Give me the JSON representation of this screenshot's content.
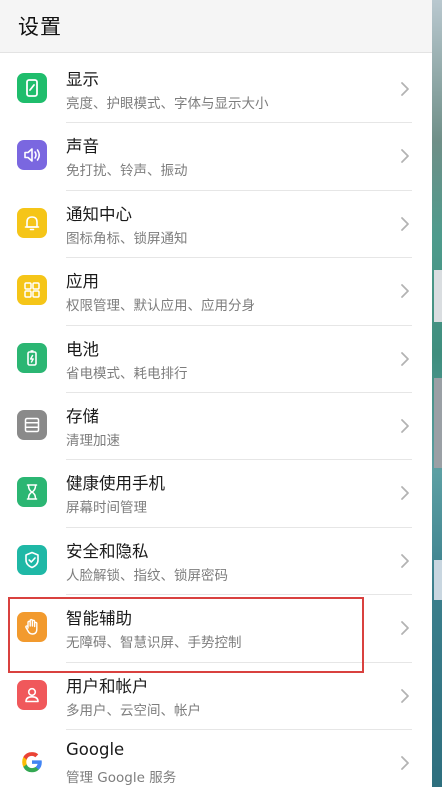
{
  "header": {
    "title": "设置"
  },
  "colors": {
    "display": "#1fbd6c",
    "sound": "#7a67e0",
    "notification": "#f5c518",
    "apps": "#f5c518",
    "battery": "#2bb673",
    "storage": "#8a8a8a",
    "health": "#2bb673",
    "security": "#1fb8a6",
    "assist": "#f29a2e",
    "accounts": "#f0585b",
    "highlight": "#d9413f"
  },
  "settings": {
    "items": [
      {
        "key": "display",
        "label": "显示",
        "sub": "亮度、护眼模式、字体与显示大小",
        "icon": "display-icon"
      },
      {
        "key": "sound",
        "label": "声音",
        "sub": "免打扰、铃声、振动",
        "icon": "speaker-icon"
      },
      {
        "key": "notification",
        "label": "通知中心",
        "sub": "图标角标、锁屏通知",
        "icon": "bell-icon"
      },
      {
        "key": "apps",
        "label": "应用",
        "sub": "权限管理、默认应用、应用分身",
        "icon": "apps-grid-icon"
      },
      {
        "key": "battery",
        "label": "电池",
        "sub": "省电模式、耗电排行",
        "icon": "battery-icon"
      },
      {
        "key": "storage",
        "label": "存储",
        "sub": "清理加速",
        "icon": "storage-icon"
      },
      {
        "key": "health",
        "label": "健康使用手机",
        "sub": "屏幕时间管理",
        "icon": "hourglass-icon"
      },
      {
        "key": "security",
        "label": "安全和隐私",
        "sub": "人脸解锁、指纹、锁屏密码",
        "icon": "shield-icon"
      },
      {
        "key": "assist",
        "label": "智能辅助",
        "sub": "无障碍、智慧识屏、手势控制",
        "icon": "hand-icon"
      },
      {
        "key": "accounts",
        "label": "用户和帐户",
        "sub": "多用户、云空间、帐户",
        "icon": "user-icon"
      },
      {
        "key": "google",
        "label": "Google",
        "sub": "管理 Google 服务",
        "icon": "google-icon"
      }
    ]
  }
}
